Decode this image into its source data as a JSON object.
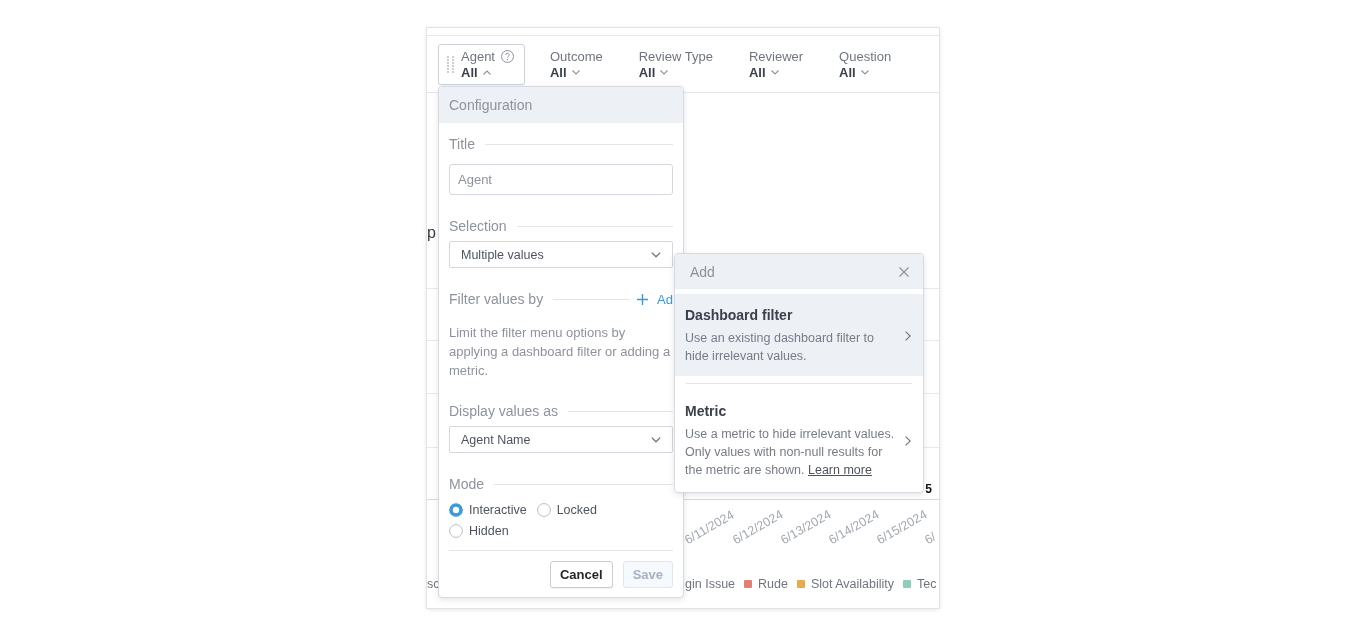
{
  "filter_bar": {
    "filters": [
      {
        "label": "Agent",
        "value": "All",
        "expanded": true
      },
      {
        "label": "Outcome",
        "value": "All",
        "expanded": false
      },
      {
        "label": "Review Type",
        "value": "All",
        "expanded": false
      },
      {
        "label": "Reviewer",
        "value": "All",
        "expanded": false
      },
      {
        "label": "Question",
        "value": "All",
        "expanded": false
      }
    ]
  },
  "background_chart": {
    "title_fragment": "p",
    "value_label": "5",
    "x_axis_labels": [
      "6/11/2024",
      "6/12/2024",
      "6/13/2024",
      "6/14/2024",
      "6/15/2024",
      "6/"
    ],
    "legend": [
      {
        "label": "sc"
      },
      {
        "label": "gin Issue"
      },
      {
        "label": "Rude",
        "color": "#e57f74"
      },
      {
        "label": "Slot Availability",
        "color": "#e9a852"
      },
      {
        "label": "Tec",
        "color": "#8ed0b6"
      }
    ]
  },
  "configuration": {
    "title": "Configuration",
    "sections": [
      {
        "kind": "input",
        "label": "Title",
        "placeholder": "Agent"
      },
      {
        "kind": "select",
        "label": "Selection",
        "value": "Multiple values"
      },
      {
        "kind": "action",
        "label": "Filter values by",
        "action": "Ad",
        "description": "Limit the filter menu options by applying a dashboard filter or adding a metric."
      },
      {
        "kind": "select",
        "label": "Display values as",
        "value": "Agent Name"
      },
      {
        "kind": "radios",
        "label": "Mode",
        "options": [
          {
            "label": "Interactive",
            "selected": true
          },
          {
            "label": "Locked",
            "selected": false
          },
          {
            "label": "Hidden",
            "selected": false
          }
        ]
      }
    ],
    "buttons": [
      {
        "label": "Cancel",
        "disabled": false
      },
      {
        "label": "Save",
        "disabled": true
      }
    ]
  },
  "add_menu": {
    "title": "Add",
    "items": [
      {
        "title": "Dashboard filter",
        "description": "Use an existing dashboard filter to hide irrelevant values.",
        "selected": true
      },
      {
        "title": "Metric",
        "description": "Use a metric to hide irrelevant values. Only values with non-null results for the metric are shown.",
        "link": "Learn more",
        "selected": false
      }
    ]
  }
}
